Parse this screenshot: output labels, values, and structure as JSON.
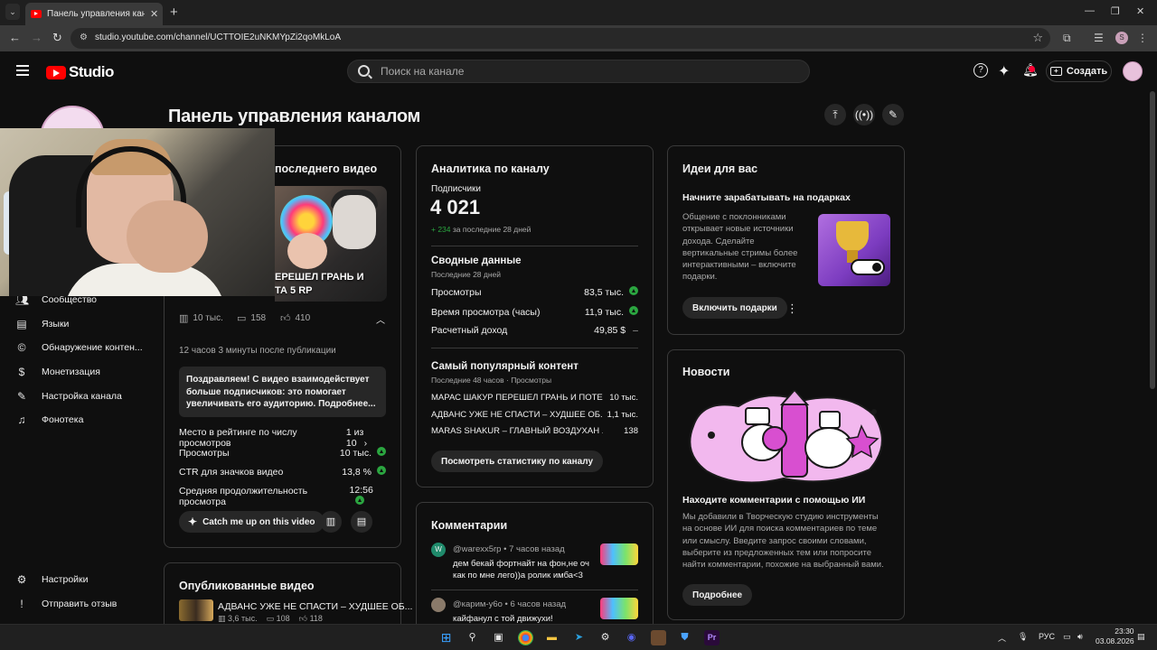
{
  "browser": {
    "tab_title": "Панель управления каналом",
    "url": "studio.youtube.com/channel/UCTTOIE2uNKMYpZi2qoMkLoA"
  },
  "header": {
    "logo_text": "Studio",
    "search_placeholder": "Поиск на канале",
    "create_label": "Создать"
  },
  "sidebar": {
    "items": [
      {
        "label": "Сообщество",
        "icon": "community-icon"
      },
      {
        "label": "Языки",
        "icon": "subtitles-icon"
      },
      {
        "label": "Обнаружение контен...",
        "icon": "copyright-icon"
      },
      {
        "label": "Монетизация",
        "icon": "dollar-icon"
      },
      {
        "label": "Настройка канала",
        "icon": "magic-wand-icon"
      },
      {
        "label": "Фонотека",
        "icon": "audio-library-icon"
      }
    ],
    "settings_label": "Настройки",
    "feedback_label": "Отправить отзыв"
  },
  "page": {
    "title": "Панель управления каналом"
  },
  "latest_video": {
    "title_partial": "последнего видео",
    "thumb_text": "ЕРЕШЕЛ ГРАНЬ И\nТА 5 RP",
    "views": "10 тыс.",
    "comments": "158",
    "likes": "410",
    "published": "12 часов 3 минуты после публикации",
    "congrats": "Поздравляем! С видео взаимодействует больше подписчиков: это помогает увеличивать его аудиторию. Подробнее...",
    "metrics": [
      {
        "label": "Место в рейтинге по числу просмотров",
        "value": "1 из 10"
      },
      {
        "label": "Просмотры",
        "value": "10 тыс."
      },
      {
        "label": "CTR для значков видео",
        "value": "13,8 %"
      },
      {
        "label": "Средняя продолжительность просмотра",
        "value": "12:56"
      }
    ],
    "catch_up_label": "Catch me up on this video"
  },
  "published": {
    "title": "Опубликованные видео",
    "first_title": "АДВАНС УЖЕ НЕ СПАСТИ – ХУДШЕЕ ОБ...",
    "first_views": "3,6 тыс.",
    "first_comments": "108",
    "first_likes": "118"
  },
  "analytics": {
    "title": "Аналитика по каналу",
    "subs_label": "Подписчики",
    "subs_value": "4 021",
    "subs_delta": "+ 234",
    "subs_period": "за последние 28 дней",
    "summary_title": "Сводные данные",
    "summary_period": "Последние 28 дней",
    "summary": [
      {
        "label": "Просмотры",
        "value": "83,5 тыс."
      },
      {
        "label": "Время просмотра (часы)",
        "value": "11,9 тыс."
      },
      {
        "label": "Расчетный доход",
        "value": "49,85 $"
      }
    ],
    "summary_dash": "–",
    "popular_title": "Самый популярный контент",
    "popular_period": "Последние 48 часов · Просмотры",
    "popular": [
      {
        "title": "МАРАС ШАКУР ПЕРЕШЕЛ ГРАНЬ И ПОТЕ...",
        "value": "10 тыс."
      },
      {
        "title": "АДВАНС УЖЕ НЕ СПАСТИ – ХУДШЕЕ ОБ...",
        "value": "1,1 тыс."
      },
      {
        "title": "MARAS SHAKUR – ГЛАВНЫЙ ВОЗДУХАН ...",
        "value": "138"
      }
    ],
    "more_btn": "Посмотреть статистику по каналу"
  },
  "comments": {
    "title": "Комментарии",
    "items": [
      {
        "author": "@warexx5rp",
        "avatar_letter": "W",
        "time": "• 7 часов назад",
        "text": "дем бекай фортнайт на фон,не оч как по мне лего))а ролик имба<3"
      },
      {
        "author": "@карим-у6о",
        "avatar_letter": "",
        "time": "• 6 часов назад",
        "text": "кайфанул с той движухи!"
      }
    ]
  },
  "ideas": {
    "title": "Идеи для вас",
    "sub_title": "Начните зарабатывать на подарках",
    "text": "Общение с поклонниками открывает новые источники дохода. Сделайте вертикальные стримы более интерактивными – включите подарки.",
    "btn": "Включить подарки"
  },
  "news": {
    "title": "Новости",
    "sub_title": "Находите комментарии с помощью ИИ",
    "text": "Мы добавили в Творческую студию инструменты на основе ИИ для поиска комментариев по теме или смыслу. Введите запрос своими словами, выберите из предложенных тем или попросите найти комментарии, похожие на выбранный вами.",
    "btn": "Подробнее"
  },
  "taskbar": {
    "lang": "РУС",
    "time": "23:30",
    "date": "03.08.2026"
  },
  "colors": {
    "accent_red": "#ff0000",
    "green_up": "#2ba640",
    "bg": "#0f0f0f"
  }
}
